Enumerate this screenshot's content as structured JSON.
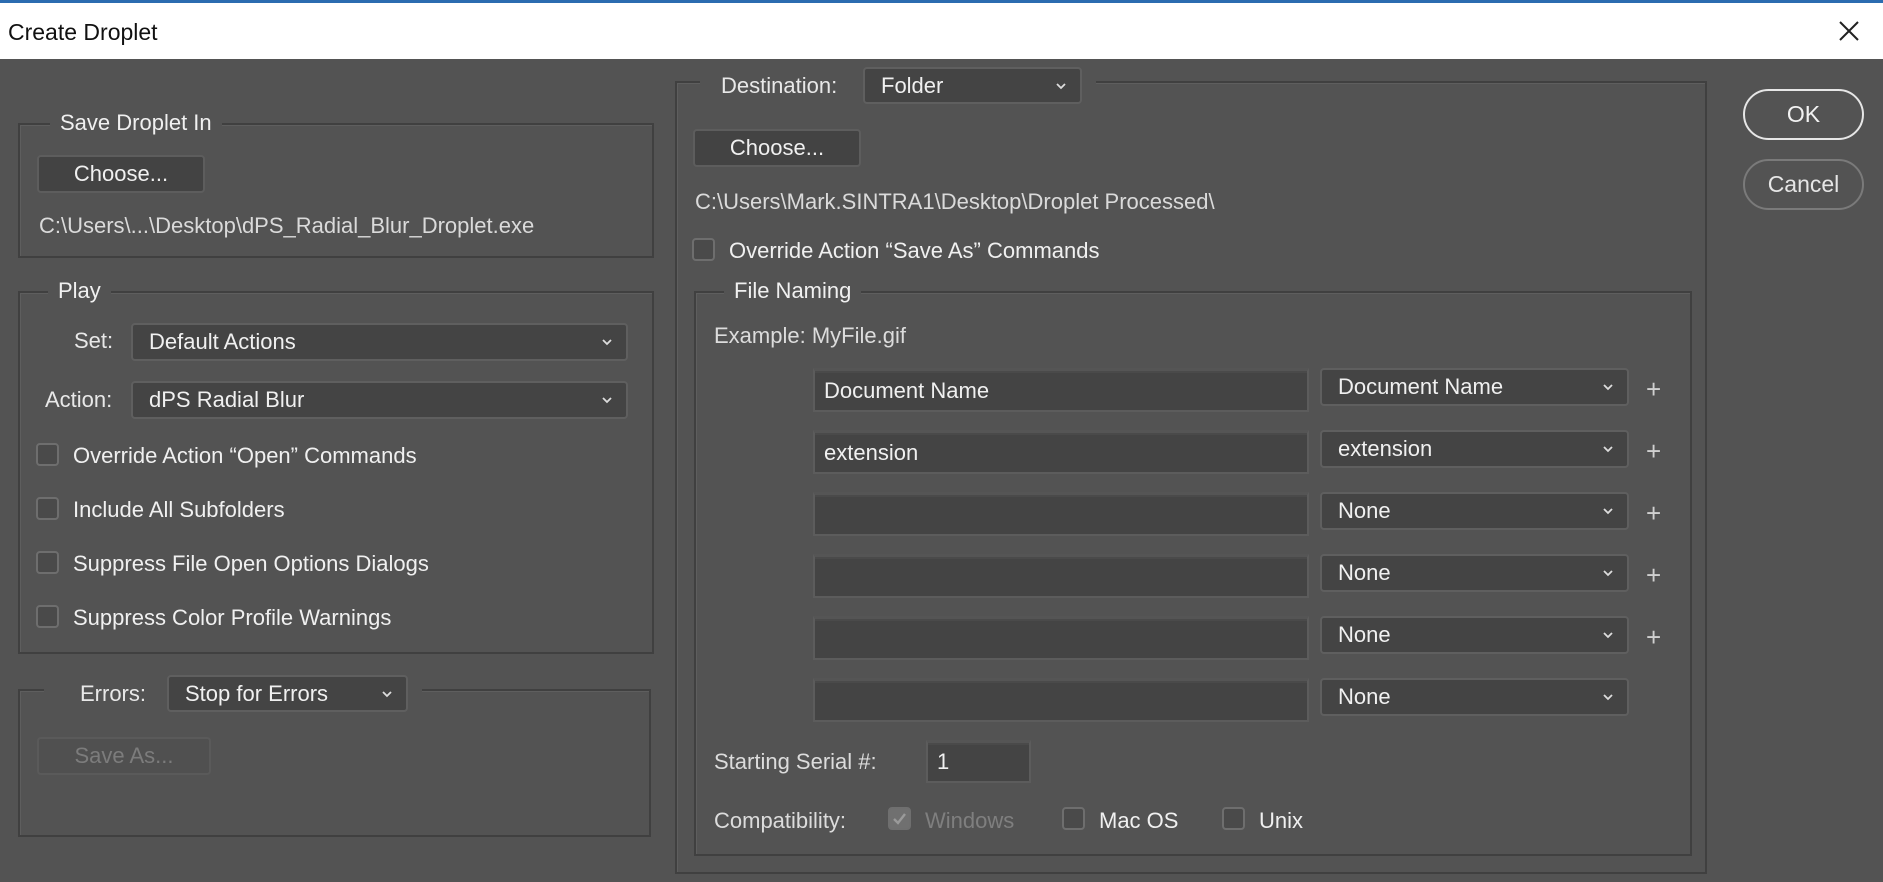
{
  "window": {
    "title": "Create Droplet",
    "close_icon": "close-x-icon"
  },
  "save_droplet_in": {
    "legend": "Save Droplet In",
    "choose_label": "Choose...",
    "path": "C:\\Users\\...\\Desktop\\dPS_Radial_Blur_Droplet.exe"
  },
  "play": {
    "legend": "Play",
    "set_label": "Set:",
    "set_value": "Default Actions",
    "action_label": "Action:",
    "action_value": "dPS Radial Blur",
    "options": [
      {
        "label": "Override Action “Open” Commands",
        "checked": false
      },
      {
        "label": "Include All Subfolders",
        "checked": false
      },
      {
        "label": "Suppress File Open Options Dialogs",
        "checked": false
      },
      {
        "label": "Suppress Color Profile Warnings",
        "checked": false
      }
    ]
  },
  "errors": {
    "label": "Errors:",
    "value": "Stop for Errors",
    "save_as_label": "Save As..."
  },
  "destination": {
    "label": "Destination:",
    "value": "Folder",
    "choose_label": "Choose...",
    "path": "C:\\Users\\Mark.SINTRA1\\Desktop\\Droplet Processed\\",
    "override_save_as": {
      "label": "Override Action “Save As” Commands",
      "checked": false
    }
  },
  "file_naming": {
    "legend": "File Naming",
    "example": "Example: MyFile.gif",
    "rows": [
      {
        "text": "Document Name",
        "select": "Document Name",
        "has_plus": true
      },
      {
        "text": "extension",
        "select": "extension",
        "has_plus": true
      },
      {
        "text": "",
        "select": "None",
        "has_plus": true
      },
      {
        "text": "",
        "select": "None",
        "has_plus": true
      },
      {
        "text": "",
        "select": "None",
        "has_plus": true
      },
      {
        "text": "",
        "select": "None",
        "has_plus": false
      }
    ],
    "plus_symbol": "+",
    "serial_label": "Starting Serial #:",
    "serial_value": "1",
    "compat_label": "Compatibility:",
    "compat": [
      {
        "label": "Windows",
        "checked": true,
        "disabled": true
      },
      {
        "label": "Mac OS",
        "checked": false,
        "disabled": false
      },
      {
        "label": "Unix",
        "checked": false,
        "disabled": false
      }
    ]
  },
  "buttons": {
    "ok": "OK",
    "cancel": "Cancel"
  },
  "colors": {
    "dialog_bg": "#535353",
    "field_bg": "#444444",
    "title_bar": "#ffffff",
    "accent_top": "#2b6cb0"
  }
}
